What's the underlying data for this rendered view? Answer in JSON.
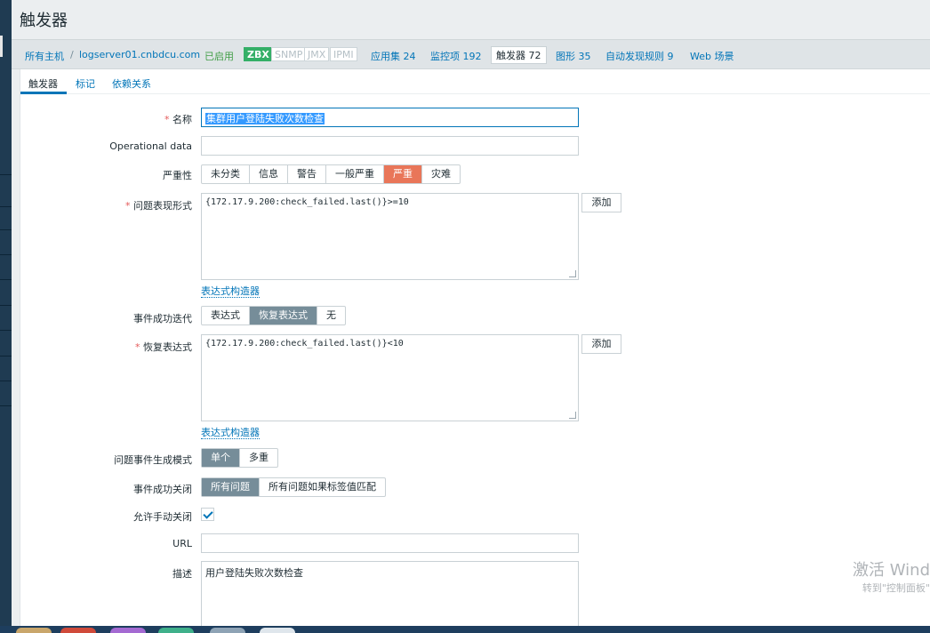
{
  "page": {
    "title": "触发器"
  },
  "hostnav": {
    "all_hosts": "所有主机",
    "separator": "/",
    "host": "logserver01.cnbdcu.com",
    "enabled": "已启用",
    "badges": [
      "ZBX",
      "SNMP",
      "JMX",
      "IPMI"
    ],
    "apps": "应用集 24",
    "items": "监控项 192",
    "triggers": "触发器 72",
    "graphs": "图形 35",
    "discovery": "自动发现规则 9",
    "web": "Web 场景"
  },
  "tabs": [
    "触发器",
    "标记",
    "依赖关系"
  ],
  "form": {
    "required_mark": "*",
    "name_label": "名称",
    "name_value": "集群用户登陆失败次数检查",
    "opdata_label": "Operational data",
    "opdata_value": "",
    "severity_label": "严重性",
    "severity_options": [
      "未分类",
      "信息",
      "警告",
      "一般严重",
      "严重",
      "灾难"
    ],
    "severity_selected": "严重",
    "problem_expr_label": "问题表现形式",
    "problem_expr_value": "{172.17.9.200:check_failed.last()}>=10",
    "add_label": "添加",
    "expr_builder": "表达式构造器",
    "ok_event_label": "事件成功迭代",
    "ok_event_options": [
      "表达式",
      "恢复表达式",
      "无"
    ],
    "ok_event_selected": "恢复表达式",
    "recovery_expr_label": "恢复表达式",
    "recovery_expr_value": "{172.17.9.200:check_failed.last()}<10",
    "gen_mode_label": "问题事件生成模式",
    "gen_mode_options": [
      "单个",
      "多重"
    ],
    "gen_mode_selected": "单个",
    "ok_close_label": "事件成功关闭",
    "ok_close_options": [
      "所有问题",
      "所有问题如果标签值匹配"
    ],
    "ok_close_selected": "所有问题",
    "manual_close_label": "允许手动关闭",
    "manual_close_checked": true,
    "url_label": "URL",
    "url_value": "",
    "desc_label": "描述",
    "desc_value": "用户登陆失败次数检查"
  },
  "watermark": {
    "line1": "激活 Wind",
    "line2": "转到\"控制面板\""
  }
}
